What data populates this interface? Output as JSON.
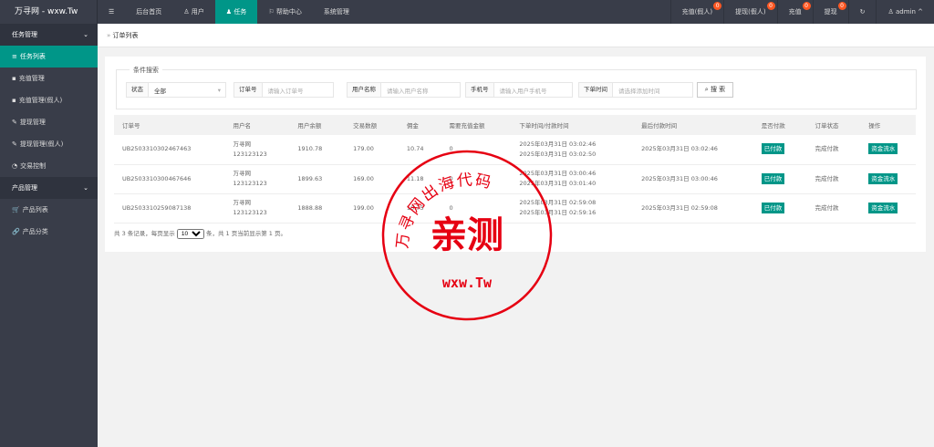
{
  "header": {
    "logo": "万寻网 - wxw.Tw",
    "menu_icon": "☰",
    "nav": [
      {
        "label": "后台首页"
      },
      {
        "label": "用户",
        "icon": "user-icon"
      },
      {
        "label": "任务",
        "icon": "walk-icon"
      },
      {
        "label": "帮助中心",
        "icon": "flag-icon"
      },
      {
        "label": "系统管理"
      }
    ],
    "right": [
      {
        "label": "充值(假人)",
        "badge": "0"
      },
      {
        "label": "提现(假人)",
        "badge": "0"
      },
      {
        "label": "充值",
        "badge": "0"
      },
      {
        "label": "提现",
        "badge": "0"
      }
    ],
    "refresh": "↻",
    "user": "admin"
  },
  "sidebar": {
    "groups": [
      {
        "label": "任务管理",
        "items": [
          {
            "label": "任务列表",
            "icon": "≡"
          },
          {
            "label": "充值管理",
            "icon": "▪"
          },
          {
            "label": "充值管理(假人)",
            "icon": "▪"
          },
          {
            "label": "提现管理",
            "icon": "✎"
          },
          {
            "label": "提现管理(假人)",
            "icon": "✎"
          },
          {
            "label": "交易控制",
            "icon": "◔"
          }
        ]
      },
      {
        "label": "产品管理",
        "items": [
          {
            "label": "产品列表",
            "icon": "🛒"
          },
          {
            "label": "产品分类",
            "icon": "🔗"
          }
        ]
      }
    ]
  },
  "breadcrumb": "订单列表",
  "search": {
    "legend": "条件搜索",
    "status_label": "状态",
    "status_value": "全部",
    "order_label": "订单号",
    "order_ph": "请输入订单号",
    "user_label": "用户名称",
    "user_ph": "请输入用户名称",
    "phone_label": "手机号",
    "phone_ph": "请输入用户手机号",
    "time_label": "下单时间",
    "time_ph": "请选择添加时间",
    "button": "搜 索"
  },
  "table": {
    "headers": [
      "订单号",
      "用户名",
      "用户余额",
      "交易数额",
      "佣金",
      "需要充值金额",
      "下单时间/付款时间",
      "最后付款时间",
      "是否付款",
      "订单状态",
      "操作"
    ],
    "rows": [
      {
        "id": "UB2503310302467463",
        "name": "万寻网",
        "phone": "123123123",
        "balance": "1910.78",
        "amount": "179.00",
        "commission": "10.74",
        "need": "0",
        "t1": "2025年03月31日 03:02:46",
        "t2": "2025年03月31日 03:02:50",
        "last": "2025年03月31日 03:02:46",
        "paid": "已付款",
        "status": "完成付款",
        "action": "资金流水"
      },
      {
        "id": "UB2503310300467646",
        "name": "万寻网",
        "phone": "123123123",
        "balance": "1899.63",
        "amount": "169.00",
        "commission": "11.18",
        "need": "0",
        "t1": "2025年03月31日 03:00:46",
        "t2": "2025年03月31日 03:01:40",
        "last": "2025年03月31日 03:00:46",
        "paid": "已付款",
        "status": "完成付款",
        "action": "资金流水"
      },
      {
        "id": "UB2503310259087138",
        "name": "万寻网",
        "phone": "123123123",
        "balance": "1888.88",
        "amount": "199.00",
        "commission": "10.75",
        "need": "0",
        "t1": "2025年03月31日 02:59:08",
        "t2": "2025年03月31日 02:59:16",
        "last": "2025年03月31日 02:59:08",
        "paid": "已付款",
        "status": "完成付款",
        "action": "资金流水"
      }
    ]
  },
  "pager": {
    "pre": "共 3 条记录，每页显示",
    "size": "10",
    "post": "条，共 1 页当前显示第 1 页。"
  },
  "stamp": {
    "arc": "万寻网出海代码",
    "center": "亲测",
    "bottom": "wxw.Tw",
    "color": "#e60012"
  }
}
